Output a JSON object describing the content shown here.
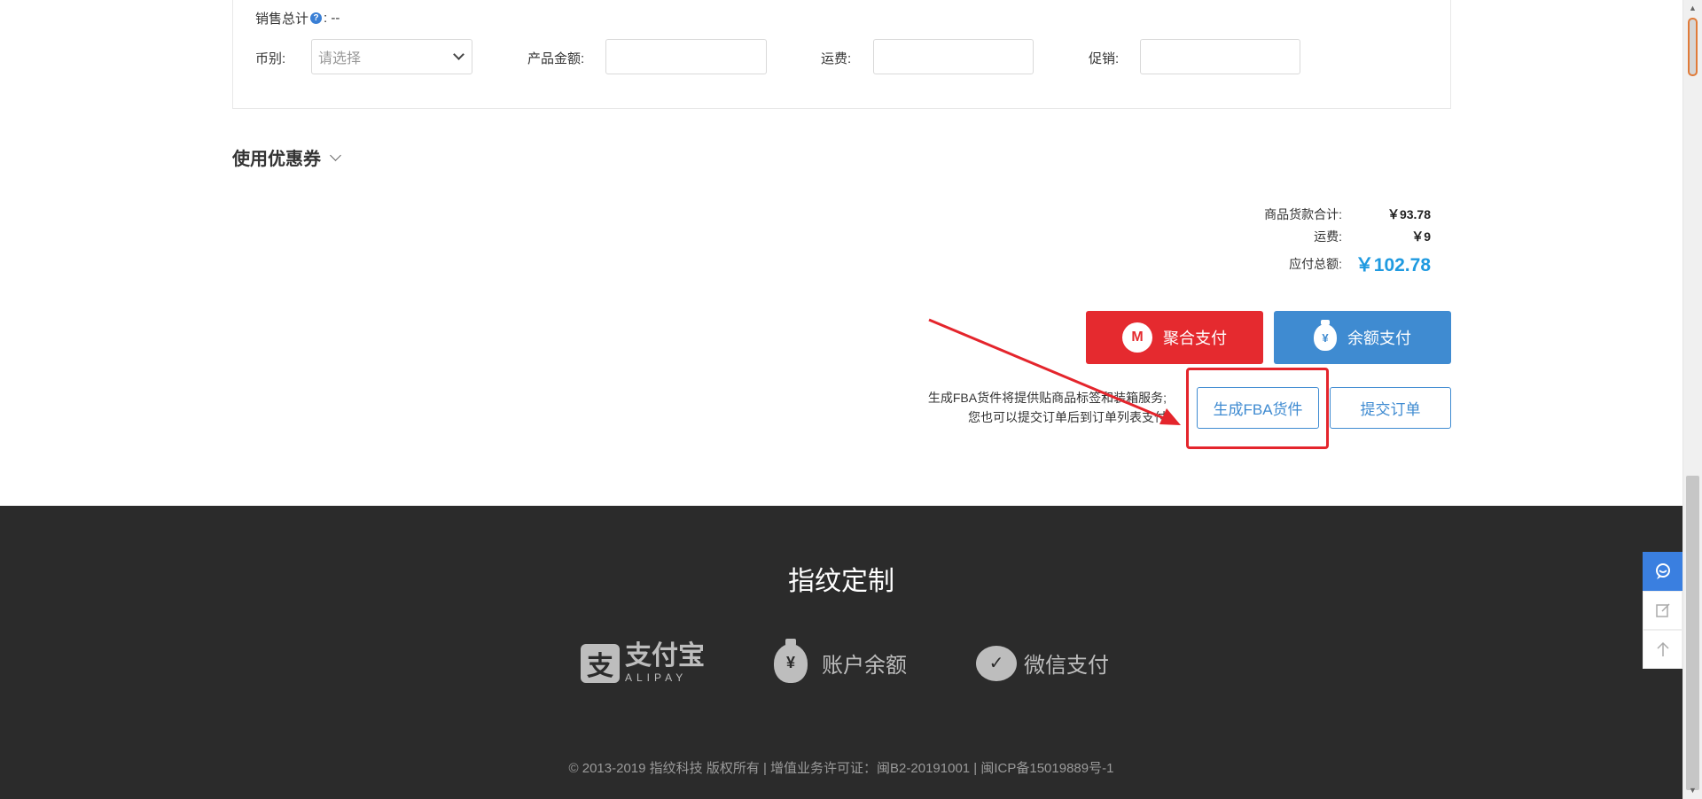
{
  "order_form": {
    "sales_total_label": "销售总计",
    "sales_total_value": ": --",
    "currency_label": "币别:",
    "currency_placeholder": "请选择",
    "product_amount_label": "产品金额:",
    "shipping_label": "运费:",
    "promotion_label": "促销:"
  },
  "coupon": {
    "label": "使用优惠券"
  },
  "summary": {
    "goods_total_label": "商品货款合计:",
    "goods_total_value": "￥93.78",
    "shipping_label": "运费:",
    "shipping_value": "￥9",
    "payable_label": "应付总额:",
    "payable_value": "￥102.78"
  },
  "payment": {
    "aggregate_pay_label": "聚合支付",
    "balance_pay_label": "余额支付"
  },
  "actions": {
    "note_line1": "生成FBA货件将提供贴商品标签和装箱服务;",
    "note_line2": "您也可以提交订单后到订单列表支付",
    "fba_button": "生成FBA货件",
    "submit_button": "提交订单"
  },
  "footer": {
    "title": "指纹定制",
    "alipay_cn": "支付宝",
    "alipay_en": "ALIPAY",
    "balance_label": "账户余额",
    "wechat_label": "微信支付",
    "copyright": "© 2013-2019 指纹科技 版权所有  |  增值业务许可证：闽B2-20191001  |  闽ICP备15019889号-1"
  },
  "icons": {
    "help": "question-icon",
    "cmb": "cmb-logo-icon",
    "bag": "money-bag-icon",
    "customer_service": "chat-icon",
    "feedback": "edit-icon",
    "back_to_top": "arrow-up-icon"
  },
  "colors": {
    "accent_blue": "#3f8bd1",
    "price_blue": "#1f9ae0",
    "pay_red": "#e52a2f",
    "annotation_red": "#e4252c",
    "footer_bg": "#2b2b2b"
  }
}
